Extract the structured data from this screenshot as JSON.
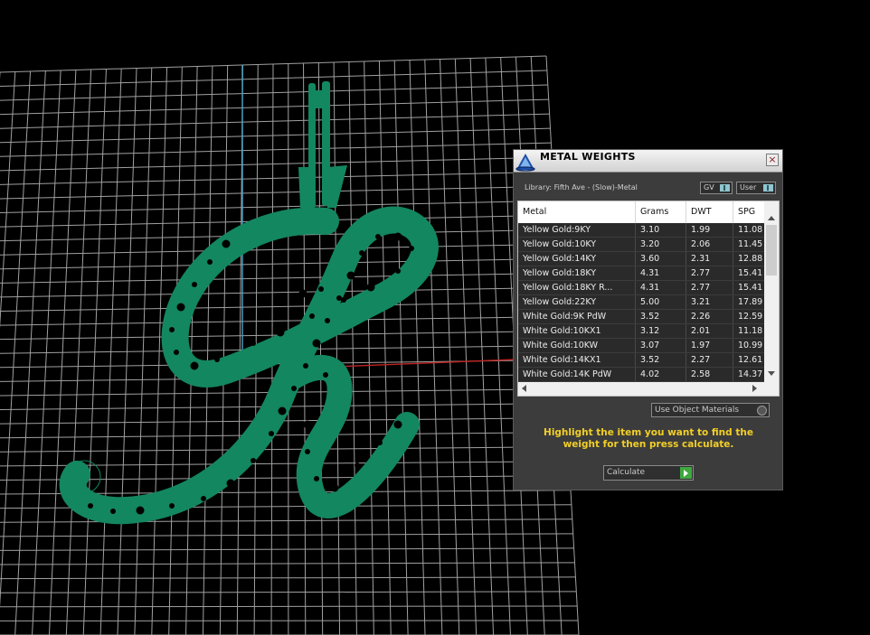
{
  "window": {
    "title": "METAL WEIGHTS",
    "close_icon": "close-icon",
    "logo_icon": "app-logo-icon"
  },
  "library_label": "Library: Fifth Ave - (Slow)-Metal",
  "toggles": {
    "gv": "GV",
    "user": "User"
  },
  "table": {
    "headers": [
      "Metal",
      "Grams",
      "DWT",
      "SPG"
    ],
    "rows": [
      [
        "Yellow Gold:9KY",
        "3.10",
        "1.99",
        "11.08"
      ],
      [
        "Yellow Gold:10KY",
        "3.20",
        "2.06",
        "11.45"
      ],
      [
        "Yellow Gold:14KY",
        "3.60",
        "2.31",
        "12.88"
      ],
      [
        "Yellow Gold:18KY",
        "4.31",
        "2.77",
        "15.41"
      ],
      [
        "Yellow Gold:18KY R...",
        "4.31",
        "2.77",
        "15.41"
      ],
      [
        "Yellow Gold:22KY",
        "5.00",
        "3.21",
        "17.89"
      ],
      [
        "White Gold:9K PdW",
        "3.52",
        "2.26",
        "12.59"
      ],
      [
        "White Gold:10KX1",
        "3.12",
        "2.01",
        "11.18"
      ],
      [
        "White Gold:10KW",
        "3.07",
        "1.97",
        "10.99"
      ],
      [
        "White Gold:14KX1",
        "3.52",
        "2.27",
        "12.61"
      ],
      [
        "White Gold:14K PdW",
        "4.02",
        "2.58",
        "14.37"
      ]
    ]
  },
  "use_object_materials": "Use Object Materials",
  "instructions": "Highlight the item you want to find the weight for then press calculate.",
  "calculate_button": "Calculate",
  "colors": {
    "model": "#13875f",
    "grid": "#bdbdbd",
    "instruction_text": "#f2cf27",
    "calc_arrow": "#3fa83f"
  }
}
